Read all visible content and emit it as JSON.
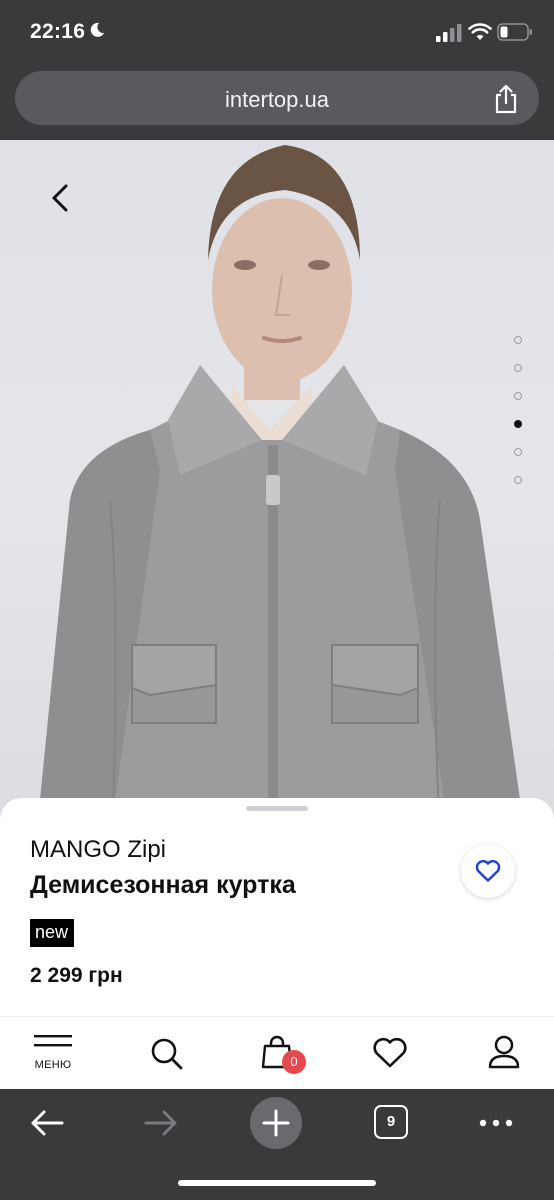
{
  "status_bar": {
    "time": "22:16"
  },
  "browser": {
    "url": "intertop.ua"
  },
  "gallery": {
    "dot_count": 6,
    "active_index": 3
  },
  "product": {
    "brand": "MANGO Zipi",
    "title": "Демисезонная куртка",
    "badge": "new",
    "price": "2 299 грн"
  },
  "app_nav": {
    "menu_label": "МЕНЮ",
    "cart_count": "0"
  },
  "browser_toolbar": {
    "tab_count": "9"
  },
  "colors": {
    "heart": "#1f3fd6",
    "cart_badge": "#e5484d",
    "chrome": "#3a3a3c"
  },
  "icons": [
    "moon-icon",
    "signal-icon",
    "wifi-icon",
    "battery-icon",
    "share-icon",
    "back-chevron-icon",
    "heart-icon",
    "menu-icon",
    "search-icon",
    "bag-icon",
    "heart-nav-icon",
    "user-icon",
    "arrow-left-icon",
    "arrow-right-icon",
    "plus-icon",
    "tabs-icon",
    "more-icon"
  ]
}
